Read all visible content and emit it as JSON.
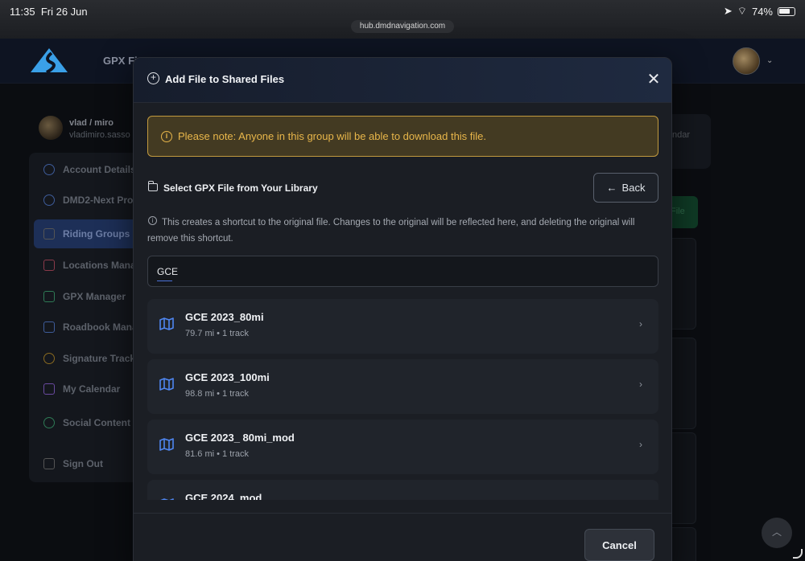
{
  "status_bar": {
    "time": "11:35",
    "date": "Fri 26 Jun",
    "url": "hub.dmdnavigation.com",
    "battery": "74%"
  },
  "header": {
    "title": "GPX Fi",
    "logo_icon": "mountain-road-logo",
    "brand_color": "#3aa0e8"
  },
  "user": {
    "name": "vlad / miro",
    "email": "vladimiro.sasso"
  },
  "sidebar": {
    "items": [
      {
        "label": "Account Details",
        "icon": "gear-icon"
      },
      {
        "label": "DMD2-Next Prof",
        "icon": "user-circle-icon"
      },
      {
        "label": "Riding Groups",
        "icon": "users-icon",
        "active": true
      },
      {
        "label": "Locations Manag",
        "icon": "pin-icon"
      },
      {
        "label": "GPX Manager",
        "icon": "route-icon"
      },
      {
        "label": "Roadbook Mana",
        "icon": "book-icon"
      },
      {
        "label": "Signature Tracks",
        "icon": "medal-icon"
      },
      {
        "label": "My Calendar",
        "icon": "calendar-icon"
      },
      {
        "label": "Social Content",
        "icon": "share-icon"
      },
      {
        "label": "Sign Out",
        "icon": "sign-out-icon"
      }
    ]
  },
  "background_page": {
    "calendar_fragment": "ndar",
    "green_button_fragment": "File"
  },
  "modal": {
    "title": "Add File to Shared Files",
    "note": "Please note: Anyone in this group will be able to download this file.",
    "section_title": "Select GPX File from Your Library",
    "back_label": "Back",
    "info_text": "This creates a shortcut to the original file. Changes to the original will be reflected here, and deleting the original will remove this shortcut.",
    "search_value": "GCE",
    "cancel_label": "Cancel",
    "warning_color": "#e8b64a",
    "files": [
      {
        "name": "GCE 2023_80mi",
        "meta": "79.7 mi • 1 track"
      },
      {
        "name": "GCE 2023_100mi",
        "meta": "98.8 mi • 1 track"
      },
      {
        "name": "GCE 2023_ 80mi_mod",
        "meta": "81.6 mi • 1 track"
      },
      {
        "name": "GCE 2024_mod",
        "meta": ""
      }
    ]
  }
}
